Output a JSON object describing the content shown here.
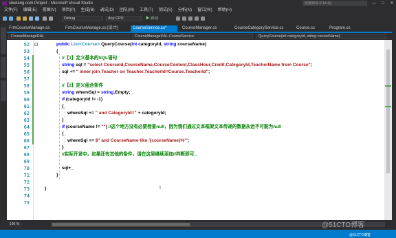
{
  "titlebar": {
    "title": "siketang.com.Project - Microsoft Visual Studio",
    "quick_launch": "快速启动 (Ctrl+Q)",
    "minimize": "—",
    "maximize": "□",
    "close": "✕"
  },
  "menu": [
    "文件(F)",
    "编辑(E)",
    "视图(V)",
    "项目(P)",
    "生成(B)",
    "调试(D)",
    "团队(M)",
    "工具(T)",
    "测试(S)",
    "分析(N)",
    "窗口(W)",
    "帮助(H)"
  ],
  "toolbar": {
    "config": "Debug",
    "platform": "Any CPU",
    "start_label": "▶ 启动"
  },
  "tabs": [
    {
      "label": "FrmCourseManage.cs",
      "active": false
    },
    {
      "label": "FrmCourseManage.cs [设计]",
      "active": false
    },
    {
      "label": "CourseService.cs*",
      "active": true
    },
    {
      "label": "CourseManager.cs",
      "active": false
    },
    {
      "label": "CourseCategoryService.cs",
      "active": false
    },
    {
      "label": "Course.cs",
      "active": false
    },
    {
      "label": "Program.cs",
      "active": false
    }
  ],
  "nav": {
    "project": "CourseManageDAL",
    "class": "CourseManageDAL.CourseService",
    "member": "QueryCourse(int categoryId, string courseName)"
  },
  "code": {
    "line_numbers": [
      "52",
      "53",
      "54",
      "55",
      "56",
      "57",
      "58",
      "59",
      "60",
      "61",
      "62",
      "63",
      "64",
      "65",
      "66",
      "67",
      "68",
      "69",
      "70",
      "71",
      "72",
      "73",
      "74",
      "75"
    ],
    "l52": {
      "kw1": "public",
      "ty1": "List<",
      "ty2": "Course",
      "ty3": ">",
      "name": " QueryCourse(",
      "kw2": "int",
      "mid": " categoryId, ",
      "kw3": "string",
      "end": " courseName)"
    },
    "l53": "{",
    "l54": "//【1】定义基本的SQL语句",
    "l55": {
      "kw": "string",
      "plain": " sql = ",
      "str": "\"select CourseId,CourseName,CourseContent,ClassHour,Credit,CategoryId,TeacherName from Course\"",
      "end": ";"
    },
    "l56": {
      "plain": "sql += ",
      "str": "\" inner join Teacher on Teacher.TeacherId=Course.TeacherId\"",
      "end": ";"
    },
    "l58": "//【2】定义组合条件",
    "l59": {
      "kw": "string",
      "plain": " whereSql = ",
      "kw2": "string",
      "end": ".Empty;"
    },
    "l60": {
      "kw": "if",
      "end": " (categoryId != -1)"
    },
    "l61": "{",
    "l62": {
      "plain": "whereSql += ",
      "str": "\" and CategoryId=\"",
      "end": " + categoryId;"
    },
    "l63": "}",
    "l64": {
      "kw": "if",
      "mid": " (courseName != ",
      "str": "\"\"",
      "end": ")",
      "cm": "//这个地方没有必要检查null，因为我们通过文本框架文本传递的数据永远不可能为null"
    },
    "l65": "{",
    "l66": {
      "plain": "whereSql += ",
      "str": "$\" and CourseName like '{courseName}%'\"",
      "end": ";"
    },
    "l67": "}",
    "l68": "//实际开发中，如果还有其他的条件，请在这里继续添加if判断即可...",
    "l70": "sql+_",
    "l71": "}",
    "l73": "}"
  },
  "zoom": "100 %",
  "watermark": "@51CTO博客",
  "watermark_small": "@51CTO博客"
}
